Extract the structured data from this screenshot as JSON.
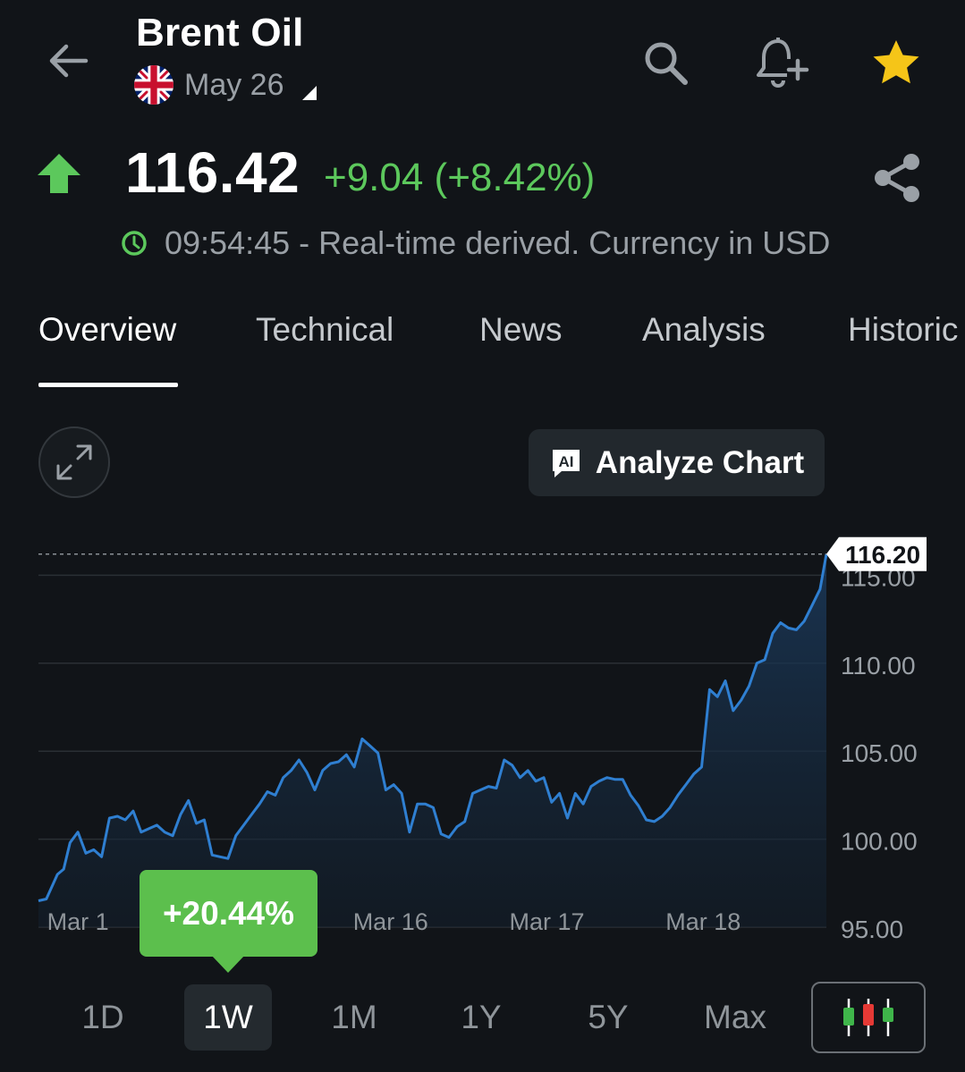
{
  "header": {
    "title": "Brent Oil",
    "contract": "May 26",
    "flag": "uk-flag",
    "icons": [
      "back-arrow-icon",
      "search-icon",
      "add-alert-icon",
      "star-icon"
    ],
    "star_color": "#f5c518"
  },
  "quote": {
    "price": "116.42",
    "change": "+9.04 (+8.42%)",
    "direction": "up",
    "meta": "09:54:45 - Real-time derived. Currency in USD",
    "up_color": "#5cc85c"
  },
  "tabs": [
    {
      "label": "Overview",
      "active": true
    },
    {
      "label": "Technical",
      "active": false
    },
    {
      "label": "News",
      "active": false
    },
    {
      "label": "Analysis",
      "active": false
    },
    {
      "label": "Historic",
      "active": false
    }
  ],
  "toolbar": {
    "analyze_label": "Analyze Chart"
  },
  "chart_data": {
    "type": "area",
    "last_price_label": "116.20",
    "last_price": 116.2,
    "ylim": [
      95,
      117
    ],
    "yticks": [
      {
        "value": 115,
        "label": "115.00"
      },
      {
        "value": 110,
        "label": "110.00"
      },
      {
        "value": 105,
        "label": "105.00"
      },
      {
        "value": 100,
        "label": "100.00"
      },
      {
        "value": 95,
        "label": "95.00"
      }
    ],
    "xticks": [
      {
        "x": 2.5,
        "label": "Mar 1"
      },
      {
        "x": 22.3,
        "label": "Mar 16"
      },
      {
        "x": 32.2,
        "label": "Mar 17"
      },
      {
        "x": 42.1,
        "label": "Mar 18"
      }
    ],
    "xlim": [
      0,
      49.9
    ],
    "series": [
      {
        "line_color": "#2f7fd1",
        "x": [
          0,
          0.5,
          1.2,
          1.6,
          2.0,
          2.5,
          3.0,
          3.5,
          4.0,
          4.5,
          5.0,
          5.5,
          6.0,
          6.5,
          7.0,
          7.5,
          8.0,
          8.5,
          9.0,
          9.5,
          10.0,
          10.5,
          11.0,
          11.5,
          12.0,
          12.5,
          13.0,
          13.5,
          14.0,
          14.5,
          15.0,
          15.5,
          16.0,
          16.5,
          17.0,
          17.5,
          18.0,
          18.5,
          19.0,
          19.5,
          20.0,
          20.5,
          21.0,
          21.5,
          22.0,
          22.5,
          23.0,
          23.5,
          24.0,
          24.5,
          25.0,
          25.5,
          26.0,
          26.5,
          27.0,
          27.5,
          28.0,
          28.5,
          29.0,
          29.5,
          30.0,
          30.5,
          31.0,
          31.5,
          32.0,
          32.5,
          33.0,
          33.5,
          34.0,
          34.5,
          35.0,
          35.5,
          36.0,
          36.5,
          37.0,
          37.5,
          38.0,
          38.5,
          39.0,
          39.5,
          40.0,
          40.5,
          41.0,
          41.5,
          42.0,
          42.5,
          43.0,
          43.5,
          44.0,
          44.5,
          45.0,
          45.5,
          46.0,
          46.5,
          47.0,
          47.5,
          48.0,
          48.5,
          49.0,
          49.5,
          49.9
        ],
        "y": [
          96.5,
          96.6,
          98.0,
          98.3,
          99.8,
          100.4,
          99.2,
          99.4,
          99.0,
          101.2,
          101.3,
          101.1,
          101.6,
          100.4,
          100.6,
          100.8,
          100.4,
          100.2,
          101.4,
          102.2,
          100.9,
          101.1,
          99.1,
          99.0,
          98.9,
          100.2,
          100.8,
          101.4,
          102.0,
          102.7,
          102.5,
          103.5,
          103.9,
          104.5,
          103.8,
          102.8,
          103.9,
          104.3,
          104.4,
          104.8,
          104.1,
          105.7,
          105.3,
          104.9,
          102.8,
          103.1,
          102.6,
          100.4,
          102.0,
          102.0,
          101.8,
          100.3,
          100.1,
          100.7,
          101.0,
          102.6,
          102.8,
          103.0,
          102.9,
          104.5,
          104.2,
          103.5,
          103.9,
          103.3,
          103.5,
          102.1,
          102.6,
          101.2,
          102.6,
          102.0,
          103.0,
          103.3,
          103.5,
          103.4,
          103.4,
          102.5,
          101.9,
          101.1,
          101.0,
          101.3,
          101.8,
          102.5,
          103.1,
          103.7,
          104.1,
          108.5,
          108.1,
          109.0,
          107.3,
          107.9,
          108.7,
          110.0,
          110.2,
          111.7,
          112.3,
          112.0,
          111.9,
          112.4,
          113.3,
          114.2,
          116.2
        ]
      }
    ]
  },
  "periods": [
    {
      "label": "1D",
      "active": false
    },
    {
      "label": "1W",
      "active": true
    },
    {
      "label": "1M",
      "active": false
    },
    {
      "label": "1Y",
      "active": false
    },
    {
      "label": "5Y",
      "active": false
    },
    {
      "label": "Max",
      "active": false
    }
  ],
  "change_badge": {
    "label": "+20.44%",
    "color": "#5cbf4d"
  }
}
